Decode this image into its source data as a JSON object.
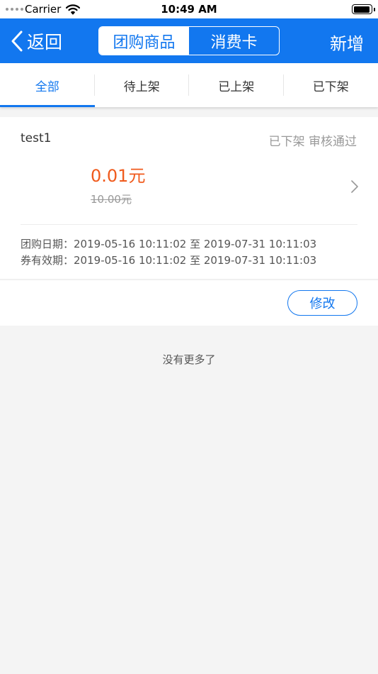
{
  "status_bar": {
    "carrier": "Carrier",
    "time": "10:49 AM",
    "battery_level": 0.92
  },
  "nav": {
    "back_label": "返回",
    "segments": [
      {
        "label": "团购商品",
        "active": true
      },
      {
        "label": "消费卡",
        "active": false
      }
    ],
    "right_label": "新增",
    "accent_color": "#1277ef"
  },
  "tabs": [
    {
      "label": "全部",
      "active": true
    },
    {
      "label": "待上架",
      "active": false
    },
    {
      "label": "已上架",
      "active": false
    },
    {
      "label": "已下架",
      "active": false
    }
  ],
  "card": {
    "name": "test1",
    "status": "已下架 审核通过",
    "price": "0.01元",
    "original_price": "10.00元",
    "price_color": "#f05a1c",
    "group_buy_label": "团购日期：",
    "group_buy_value": "2019-05-16 10:11:02 至 2019-07-31 10:11:03",
    "validity_label": "券有效期：",
    "validity_value": "2019-05-16 10:11:02 至 2019-07-31 10:11:03",
    "edit_label": "修改"
  },
  "list_end_text": "没有更多了",
  "icons": {
    "back": "chevron-left-icon",
    "detail": "chevron-right-icon",
    "wifi": "wifi-icon",
    "battery": "battery-icon",
    "signal": "signal-dots-icon"
  }
}
